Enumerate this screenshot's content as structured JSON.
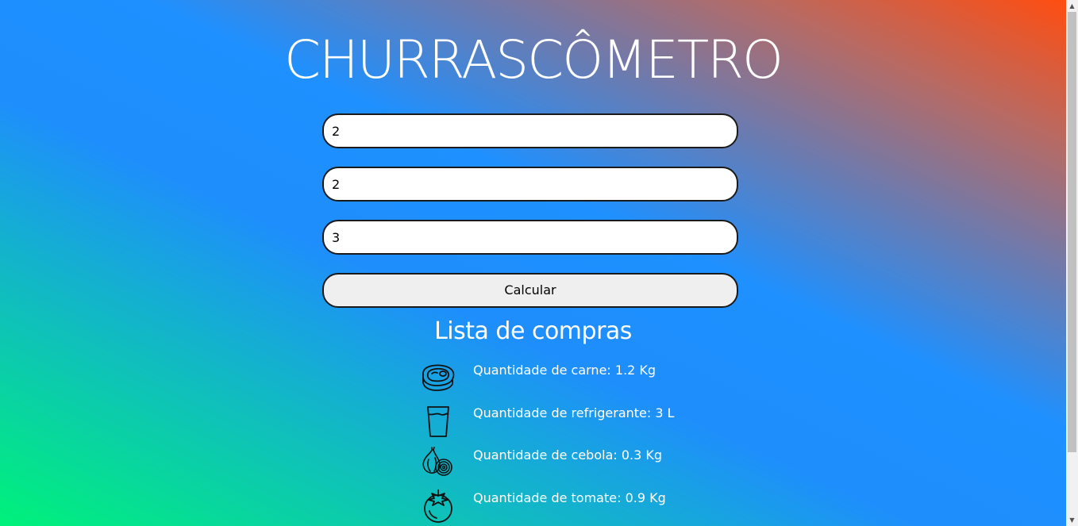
{
  "header": {
    "title": "CHURRASCÔMETRO"
  },
  "form": {
    "field1_value": "2",
    "field2_value": "2",
    "field3_value": "3",
    "calculate_label": "Calcular"
  },
  "shopping_list": {
    "title": "Lista de compras",
    "items": [
      {
        "icon": "steak-icon",
        "label": "Quantidade de carne: 1.2 Kg"
      },
      {
        "icon": "glass-icon",
        "label": "Quantidade de refrigerante: 3 L"
      },
      {
        "icon": "onion-icon",
        "label": "Quantidade de cebola: 0.3 Kg"
      },
      {
        "icon": "tomato-icon",
        "label": "Quantidade de tomate: 0.9 Kg"
      }
    ]
  },
  "colors": {
    "gradient_top_right": "#ff4d10",
    "gradient_middle": "#1e90ff",
    "gradient_bottom_left": "#00f27a",
    "text": "#ffffff"
  }
}
